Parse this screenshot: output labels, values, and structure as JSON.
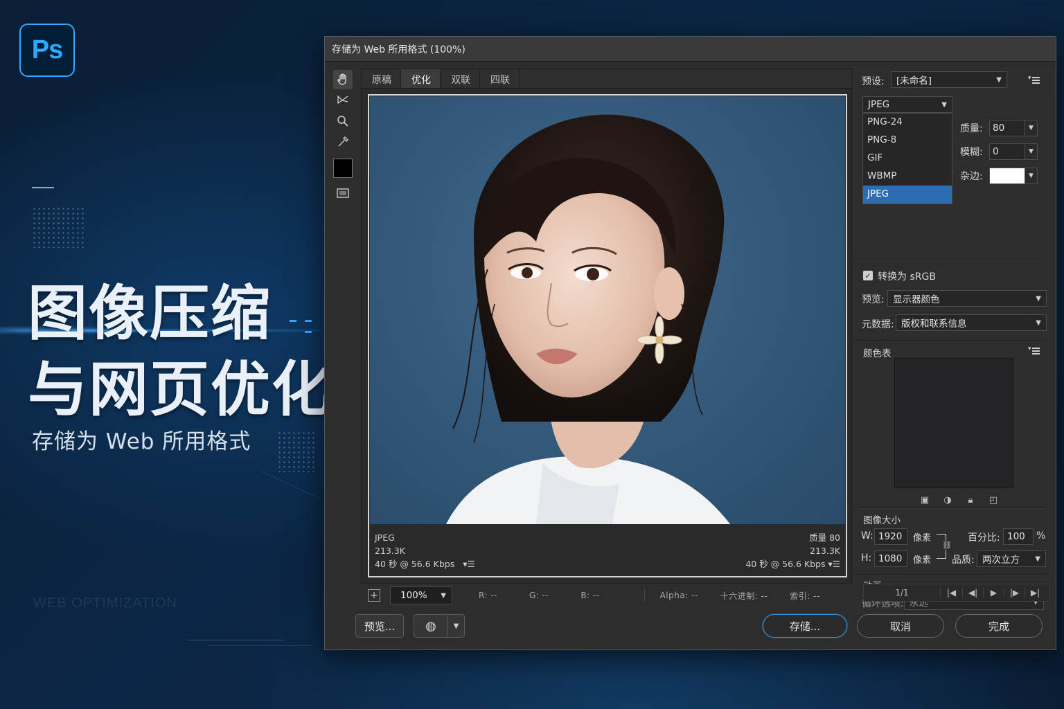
{
  "promo": {
    "logo": "Ps",
    "title_line1": "图像压缩",
    "title_line2": "与网页优化",
    "subtitle": "存储为 Web 所用格式",
    "watermark": "WEB OPTIMIZATION"
  },
  "dialog": {
    "title": "存储为 Web 所用格式 (100%)",
    "tabs": [
      {
        "label": "原稿",
        "active": false
      },
      {
        "label": "优化",
        "active": true
      },
      {
        "label": "双联",
        "active": false
      },
      {
        "label": "四联",
        "active": false
      }
    ],
    "tools": [
      "hand-icon",
      "slice-select-icon",
      "zoom-icon",
      "eyedropper-icon",
      "color-swatch",
      "toggle-slices-icon"
    ],
    "swatch_color": "#000000",
    "image_info": {
      "left_format": "JPEG",
      "left_size": "213.3K",
      "left_time": "40 秒 @ 56.6 Kbps",
      "right_quality": "质量 80",
      "right_size": "213.3K",
      "right_time": "40 秒 @ 56.6 Kbps"
    },
    "footer": {
      "zoom": "100%",
      "r": "R: --",
      "g": "G: --",
      "b": "B: --",
      "alpha": "Alpha: --",
      "hex": "十六进制: --",
      "index": "索引: --"
    },
    "buttons": {
      "preview": "预览...",
      "save": "存储...",
      "cancel": "取消",
      "done": "完成"
    }
  },
  "settings": {
    "preset_label": "预设:",
    "preset_value": "[未命名]",
    "format_value": "JPEG",
    "format_options": [
      {
        "label": "PNG-24",
        "selected": false
      },
      {
        "label": "PNG-8",
        "selected": false
      },
      {
        "label": "GIF",
        "selected": false
      },
      {
        "label": "WBMP",
        "selected": false
      },
      {
        "label": "JPEG",
        "selected": true
      }
    ],
    "quality_label": "质量:",
    "quality_value": "80",
    "blur_label": "模糊:",
    "blur_value": "0",
    "matte_label": "杂边:",
    "matte_color": "#ffffff",
    "convert_srgb_label": "转换为 sRGB",
    "convert_srgb_checked": true,
    "preview_label": "预览:",
    "preview_value": "显示器颜色",
    "metadata_label": "元数据:",
    "metadata_value": "版权和联系信息",
    "color_table_label": "颜色表",
    "image_size_label": "图像大小",
    "w_label": "W:",
    "w_value": "1920",
    "h_label": "H:",
    "h_value": "1080",
    "unit": "像素",
    "percent_label": "百分比:",
    "percent_value": "100",
    "percent_sign": "%",
    "quality2_label": "品质:",
    "quality2_value": "两次立方",
    "animation_label": "动画",
    "loop_label": "循环选项:",
    "loop_value": "永远",
    "frame_counter": "1/1"
  }
}
